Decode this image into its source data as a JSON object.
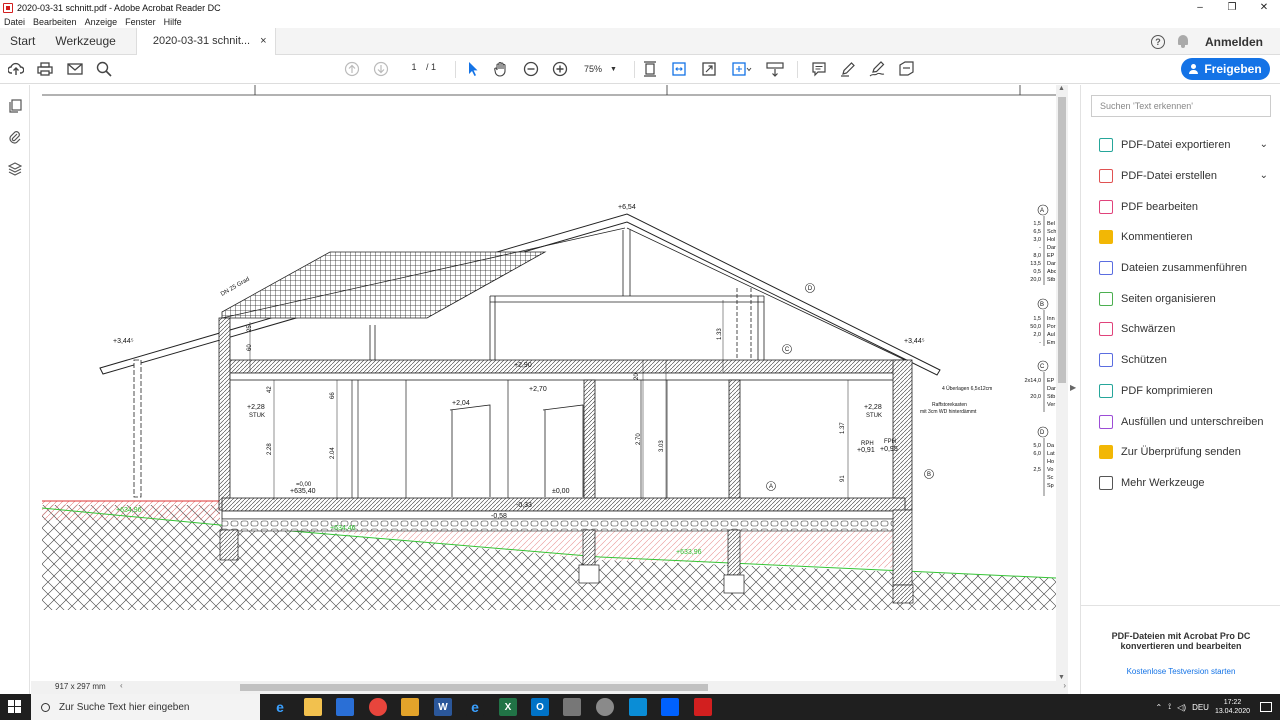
{
  "window": {
    "title": "2020-03-31 schnitt.pdf - Adobe Acrobat Reader DC",
    "minimize": "–",
    "restore": "❐",
    "close": "✕"
  },
  "menu": [
    "Datei",
    "Bearbeiten",
    "Anzeige",
    "Fenster",
    "Hilfe"
  ],
  "tabs": {
    "home": "Start",
    "tools": "Werkzeuge",
    "document": "2020-03-31 schnit...",
    "close": "×",
    "help": "?",
    "signin": "Anmelden"
  },
  "toolbar": {
    "page_current": "1",
    "page_total": "/ 1",
    "zoom": "75%",
    "share": "Freigeben"
  },
  "document": {
    "page_size": "917 x 297 mm"
  },
  "drawing_labels": {
    "ridge": "+6,54",
    "eave_left": "+3,44⁵",
    "eave_right": "+3,44⁵",
    "roof_pitch": "DN 25 Grad",
    "ceiling_1": "+2,90",
    "ceiling_2": "+2,70",
    "stuk_left_level": "+2,28",
    "stuk_left": "STUK",
    "stuk_right_level": "+2,28",
    "stuk_right": "STUK",
    "door_top": "+2,04",
    "floor_zero": "±0,00",
    "floor_left_1": "=0,00",
    "floor_left_2": "+635,40",
    "minus_033": "-0,33",
    "minus_058": "-0,58",
    "ground_left": "+634,96",
    "ground_mid": "+634,46",
    "ground_right": "+633,96",
    "rph": "RPH",
    "rph_val": "+0,91",
    "fph": "FPH",
    "fph_val": "+0,95",
    "overlay": "4 Überlagen 6,5x12cm",
    "raff1": "Raffstorekasten",
    "raff2": "mit 3cm WD hinterdämmt",
    "d60": "60",
    "d25": "25",
    "d42": "42",
    "d228": "2.28",
    "d66": "66",
    "d204": "2.04",
    "d270": "2.70",
    "d303": "3.03",
    "d133": "1.33",
    "d137": "1.37",
    "d91": "91",
    "d20": "20",
    "markA": "A",
    "markB": "B",
    "markC": "C",
    "markD": "D",
    "legendA": [
      "1,5",
      "6,5",
      "3,0",
      "-",
      "8,0",
      "13,5",
      "0,5",
      "20,0"
    ],
    "legendA_text": [
      "Bel",
      "Sch",
      "Hol",
      "Dar",
      "EP",
      "Dar",
      "Abc",
      "Stb"
    ],
    "legendB": [
      "1,5",
      "50,0",
      "2,0",
      "-"
    ],
    "legendB_text": [
      "Inn",
      "Por",
      "Aul",
      "Em"
    ],
    "legendC": [
      "2x14,0",
      "",
      "20,0"
    ],
    "legendC_text": [
      "EP",
      "Dar",
      "Stb",
      "Ver"
    ],
    "legendD": [
      "5,0",
      "6,0",
      "",
      "2,5"
    ],
    "legendD_text": [
      "Da",
      "Lat",
      "Ho",
      "Vo",
      "Sc",
      "Sp"
    ]
  },
  "right_panel": {
    "search_placeholder": "Suchen 'Text erkennen'",
    "tools": [
      {
        "label": "PDF-Datei exportieren",
        "color": "#26a69a",
        "chevron": "⌄"
      },
      {
        "label": "PDF-Datei erstellen",
        "color": "#e05252",
        "chevron": "⌄"
      },
      {
        "label": "PDF bearbeiten",
        "color": "#e0437b",
        "chevron": ""
      },
      {
        "label": "Kommentieren",
        "color": "#f2b705",
        "chevron": ""
      },
      {
        "label": "Dateien zusammenführen",
        "color": "#5b6de0",
        "chevron": ""
      },
      {
        "label": "Seiten organisieren",
        "color": "#4caf50",
        "chevron": ""
      },
      {
        "label": "Schwärzen",
        "color": "#e0437b",
        "chevron": ""
      },
      {
        "label": "Schützen",
        "color": "#5b6de0",
        "chevron": ""
      },
      {
        "label": "PDF komprimieren",
        "color": "#26a69a",
        "chevron": ""
      },
      {
        "label": "Ausfüllen und unterschreiben",
        "color": "#9c4dd6",
        "chevron": ""
      },
      {
        "label": "Zur Überprüfung senden",
        "color": "#f2b705",
        "chevron": ""
      },
      {
        "label": "Mehr Werkzeuge",
        "color": "#555555",
        "chevron": ""
      }
    ],
    "promo_line1": "PDF-Dateien mit Acrobat Pro DC",
    "promo_line2": "konvertieren und bearbeiten",
    "promo_link": "Kostenlose Testversion starten"
  },
  "taskbar": {
    "search": "Zur Suche Text hier eingeben",
    "lang": "DEU",
    "time": "17:22",
    "date": "13.04.2020"
  }
}
